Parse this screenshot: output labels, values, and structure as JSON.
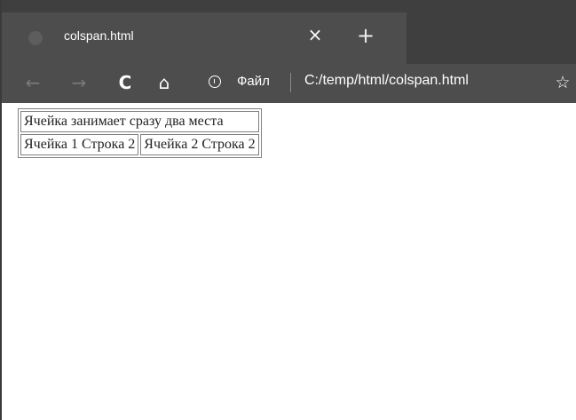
{
  "browser": {
    "tab": {
      "title": "colspan.html"
    },
    "toolbar": {
      "back_icon": "←",
      "forward_icon": "→",
      "reload_icon": "C",
      "home_icon": "⌂",
      "site_label": "Файл",
      "url": "C:/temp/html/colspan.html",
      "favorite_icon": "☆"
    },
    "tab_close_icon": "×",
    "new_tab_icon": "+"
  },
  "table": {
    "rows": [
      {
        "cells": [
          "Ячейка занимает сразу два места"
        ]
      },
      {
        "cells": [
          "Ячейка 1 Строка 2",
          "Ячейка 2 Строка 2"
        ]
      }
    ]
  }
}
